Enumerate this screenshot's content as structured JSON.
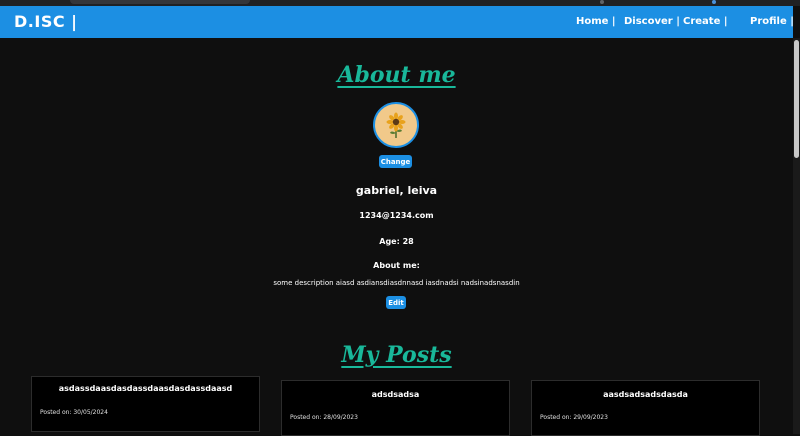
{
  "nav": {
    "brand": "D.ISC |",
    "links": [
      "Home |",
      "Discover |",
      "Create |",
      "Profile |"
    ]
  },
  "about": {
    "heading": "About me",
    "change_button": "Change",
    "name": "gabriel, leiva",
    "email": "1234@1234.com",
    "age": "Age: 28",
    "about_label": "About me:",
    "description": "some description aiasd asdiansdiasdnnasd iasdnadsi nadsinadsnasdin",
    "edit_button": "Edit"
  },
  "posts": {
    "heading": "My Posts",
    "items": [
      {
        "title": "asdassdaasdasdassdaasdasdassdaasd",
        "date": "Posted on: 30/05/2024"
      },
      {
        "title": "adsdsadsa",
        "date": "Posted on: 28/09/2023"
      },
      {
        "title": "aasdsadsadsdasda",
        "date": "Posted on: 29/09/2023"
      }
    ]
  },
  "colors": {
    "navbar": "#1c8fe3",
    "accent_heading": "#19b89a",
    "background": "#0f0f0f",
    "avatar_bg": "#f1c98a"
  },
  "icons": {
    "avatar_image": "sunflower-icon"
  }
}
